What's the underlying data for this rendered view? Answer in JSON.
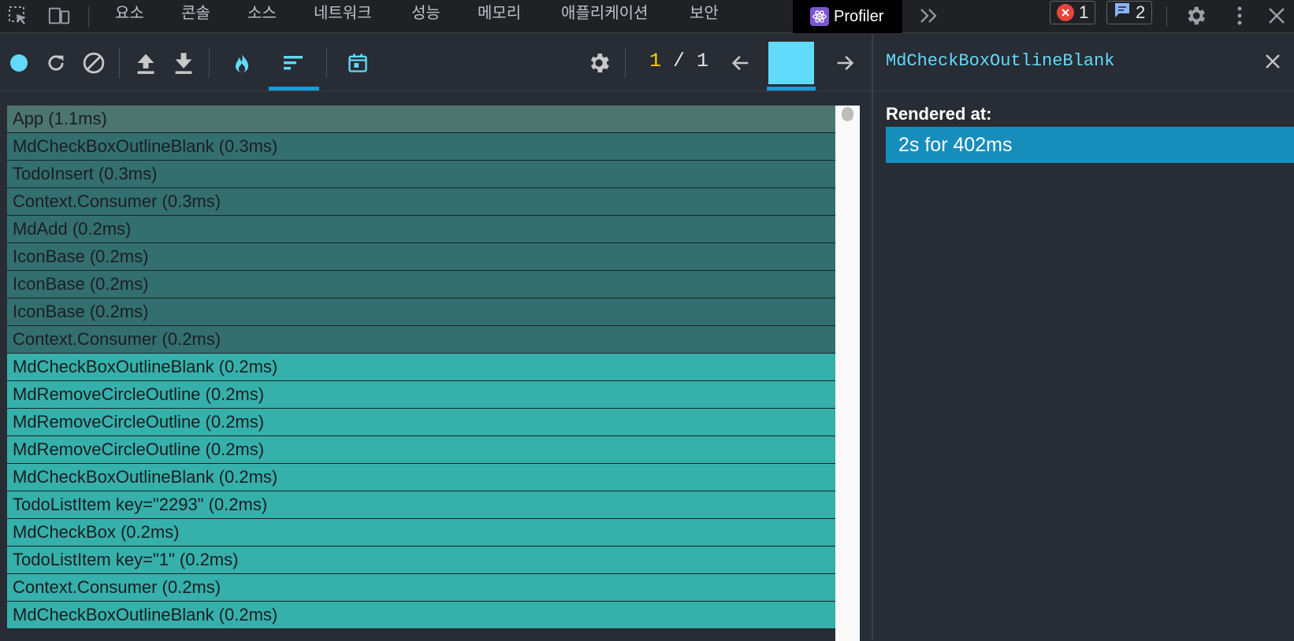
{
  "devtools": {
    "tabs": [
      {
        "label": "요소"
      },
      {
        "label": "콘솔"
      },
      {
        "label": "소스"
      },
      {
        "label": "네트워크"
      },
      {
        "label": "성능"
      },
      {
        "label": "메모리"
      },
      {
        "label": "애플리케이션"
      },
      {
        "label": "보안"
      }
    ],
    "active_tab": "Profiler",
    "error_count": "1",
    "message_count": "2"
  },
  "toolbar": {
    "commit_current": "1",
    "commit_separator": " / ",
    "commit_total": "1",
    "colors": {
      "record": "#61dafb",
      "selected_commit": "#61dafb",
      "underline": "#1a9ad6"
    }
  },
  "flame_rows": [
    {
      "label": "App (1.1ms)",
      "color": "#4c7570"
    },
    {
      "label": "MdCheckBoxOutlineBlank (0.3ms)",
      "color": "#336f6f"
    },
    {
      "label": "TodoInsert (0.3ms)",
      "color": "#336f6f"
    },
    {
      "label": "Context.Consumer (0.3ms)",
      "color": "#336f6f"
    },
    {
      "label": "MdAdd (0.2ms)",
      "color": "#336f6f"
    },
    {
      "label": "IconBase (0.2ms)",
      "color": "#336f6f"
    },
    {
      "label": "IconBase (0.2ms)",
      "color": "#336f6f"
    },
    {
      "label": "IconBase (0.2ms)",
      "color": "#336f6f"
    },
    {
      "label": "Context.Consumer (0.2ms)",
      "color": "#336f6f"
    },
    {
      "label": "MdCheckBoxOutlineBlank (0.2ms)",
      "color": "#36b0aa"
    },
    {
      "label": "MdRemoveCircleOutline (0.2ms)",
      "color": "#36b0aa"
    },
    {
      "label": "MdRemoveCircleOutline (0.2ms)",
      "color": "#36b0aa"
    },
    {
      "label": "MdRemoveCircleOutline (0.2ms)",
      "color": "#36b0aa"
    },
    {
      "label": "MdCheckBoxOutlineBlank (0.2ms)",
      "color": "#36b0aa"
    },
    {
      "label": "TodoListItem key=\"2293\" (0.2ms)",
      "color": "#36b0aa"
    },
    {
      "label": "MdCheckBox (0.2ms)",
      "color": "#36b0aa"
    },
    {
      "label": "TodoListItem key=\"1\" (0.2ms)",
      "color": "#36b0aa"
    },
    {
      "label": "Context.Consumer (0.2ms)",
      "color": "#36b0aa"
    },
    {
      "label": "MdCheckBoxOutlineBlank (0.2ms)",
      "color": "#36b0aa"
    }
  ],
  "sidebar": {
    "title": "MdCheckBoxOutlineBlank",
    "rendered_at_label": "Rendered at:",
    "rendered_at_items": [
      {
        "label": "2s for 402ms"
      }
    ]
  }
}
